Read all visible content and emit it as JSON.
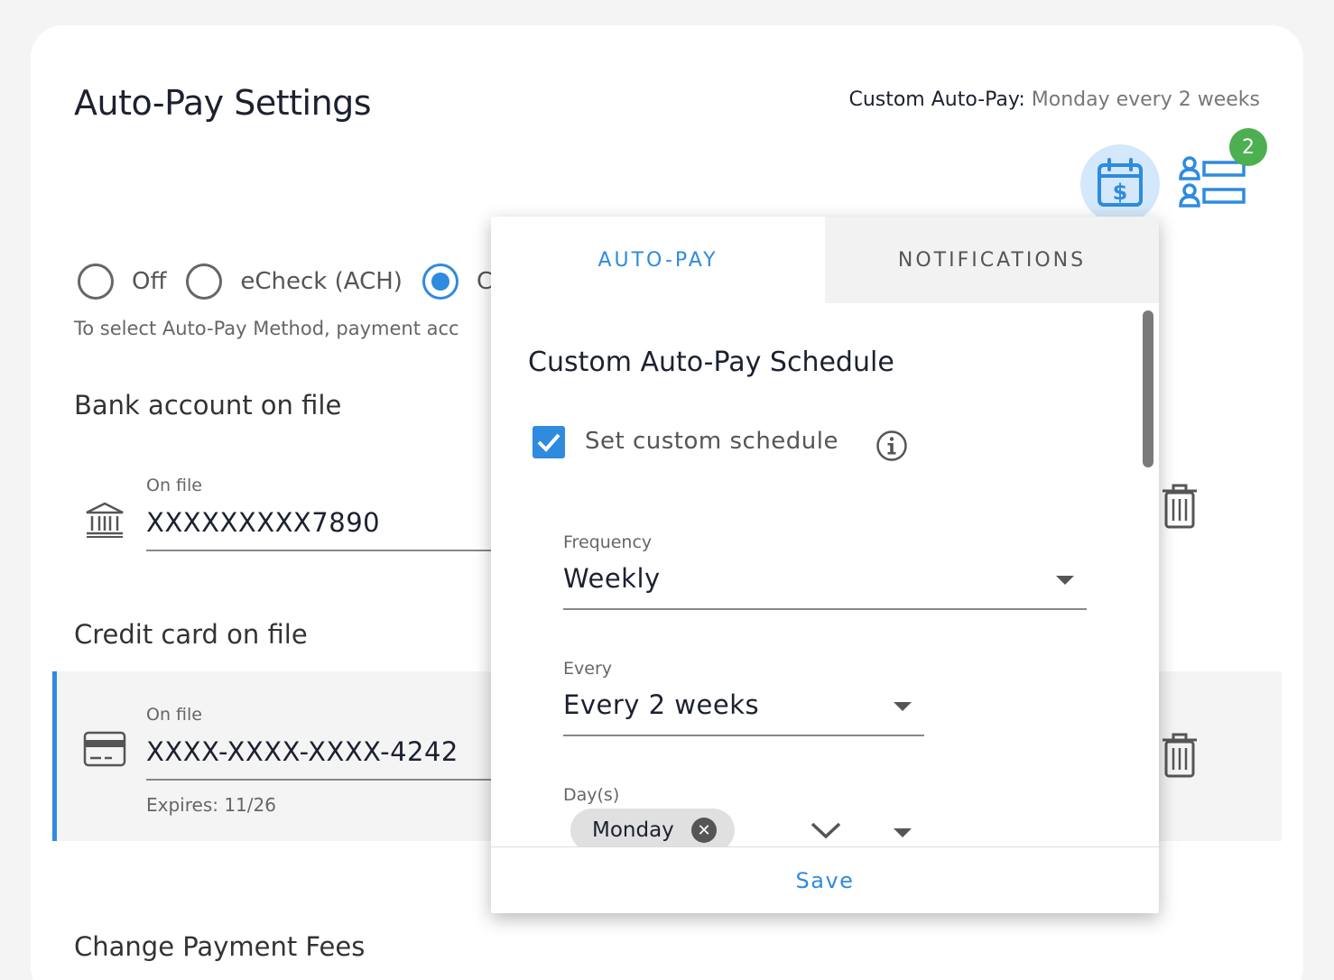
{
  "page": {
    "title": "Auto-Pay Settings",
    "summary_label": "Custom Auto-Pay:",
    "summary_value": "Monday every 2 weeks",
    "badge_count": "2"
  },
  "method": {
    "options": [
      {
        "label": "Off",
        "selected": false
      },
      {
        "label": "eCheck (ACH)",
        "selected": false
      },
      {
        "label": "C",
        "selected": true
      }
    ],
    "hint": "To select Auto-Pay Method, payment acc"
  },
  "bank": {
    "heading": "Bank account on file",
    "label": "On file",
    "value": "XXXXXXXXX7890",
    "icon": "bank-icon"
  },
  "credit": {
    "heading": "Credit card on file",
    "label": "On file",
    "value": "XXXX-XXXX-XXXX-4242",
    "expires": "Expires: 11/26",
    "icon": "credit-card-icon"
  },
  "fees": {
    "heading": "Change Payment Fees"
  },
  "popover": {
    "tabs": [
      {
        "label": "AUTO-PAY",
        "active": true
      },
      {
        "label": "NOTIFICATIONS",
        "active": false
      }
    ],
    "title": "Custom Auto-Pay Schedule",
    "checkbox_label": "Set custom schedule",
    "checkbox_checked": true,
    "frequency": {
      "label": "Frequency",
      "value": "Weekly"
    },
    "every": {
      "label": "Every",
      "value": "Every 2 weeks"
    },
    "days": {
      "label": "Day(s)",
      "chips": [
        "Monday"
      ]
    },
    "save_label": "Save"
  },
  "colors": {
    "accent": "#2f8bde",
    "badge": "#4caf50"
  }
}
